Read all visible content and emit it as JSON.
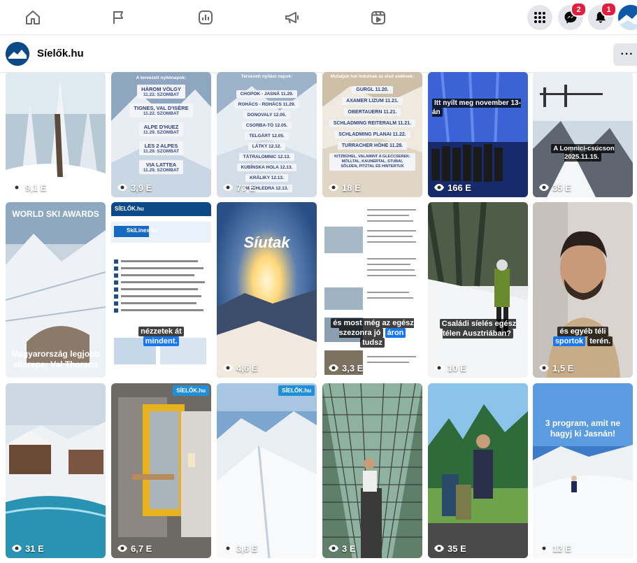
{
  "nav": {
    "icons": [
      "home-icon",
      "flag-icon",
      "insights-icon",
      "megaphone-icon",
      "video-icon"
    ],
    "messenger_badge": "2",
    "notifications_badge": "1"
  },
  "page": {
    "name": "Síelők.hu",
    "avatar_text": "SÍELŐK.hu",
    "more": "···"
  },
  "tiles": [
    {
      "views": "9,1 E"
    },
    {
      "views": "3,9 E",
      "header": "A tervezett nyitónapok:",
      "items": [
        {
          "title": "HÁROM VÖLGY",
          "sub": "11.22. SZOMBAT"
        },
        {
          "title": "TIGNES, VAL D'ISÈRE",
          "sub": "11.22. SZOMBAT"
        },
        {
          "title": "ALPE D'HUEZ",
          "sub": "11.29. SZOMBAT"
        },
        {
          "title": "LES 2 ALPES",
          "sub": "11.29. SZOMBAT"
        },
        {
          "title": "VIA LATTEA",
          "sub": "11.29. SZOMBAT"
        }
      ]
    },
    {
      "views": "73 E",
      "header": "Tervezett nyitási napok:",
      "items": [
        {
          "title": "CHOPOK - JASNÁ 11.29."
        },
        {
          "title": "ROHÁCS - ROHÁCS 11.29."
        },
        {
          "title": "DONOVALY 12.05."
        },
        {
          "title": "CSORBA-TÓ 12.05."
        },
        {
          "title": "TELGÁRT 12.05."
        },
        {
          "title": "LÁTKY 12.12."
        },
        {
          "title": "TÁTRALOMNIC 12.13."
        },
        {
          "title": "KUBÍNSKA HOLA 12.13."
        },
        {
          "title": "KRÁLIKY 12.13."
        },
        {
          "title": "MACHLEDRA 12.13."
        }
      ]
    },
    {
      "views": "18 E",
      "header": "Mutatjuk hol indulnak az első síelések:",
      "items": [
        {
          "title": "GURGL 11.20."
        },
        {
          "title": "AXAMER LIZUM 11.21."
        },
        {
          "title": "OBERTAUERN 11.21."
        },
        {
          "title": "SCHLADMING REITERALM 11.21."
        },
        {
          "title": "SCHLADMING PLANAI 11.22."
        },
        {
          "title": "TURRACHER HÖHE 11.28."
        },
        {
          "title": "KITZBÜHEL, VALAMINT A GLECCSEREK: MÖLLTAL, KAUNERTAL, STUBAI, SÖLDEN, PITZTAL ÉS HINTERTUX"
        }
      ]
    },
    {
      "views": "166 E",
      "caption": "Itt nyílt meg november 13-án"
    },
    {
      "views": "35 E",
      "caption": "A Lomnici-csúcson 2025.11.15."
    },
    {
      "views": "",
      "caption": "Magyarország legjobb síterepe: Val Thorens",
      "logo": "WORLD SKI AWARDS"
    },
    {
      "views": "",
      "caption_a": "nézzetek át",
      "caption_b": "mindent.",
      "brand": "SÍELŐK.hu",
      "site": "SkiLines.hu"
    },
    {
      "views": "4,6 E",
      "logo": "Síutak"
    },
    {
      "views": "3,3 E",
      "caption_a": "és most még az egész szezonra jó",
      "caption_b": "áron",
      "caption_c": "tudsz"
    },
    {
      "views": "10 E",
      "caption": "Családi síelés egész télen Ausztriában?"
    },
    {
      "views": "1,5 E",
      "caption_a": "és egyéb téli",
      "caption_b": "sportok",
      "caption_c": "terén."
    },
    {
      "views": "31 E"
    },
    {
      "views": "6,7 E",
      "brand": "SÍELŐK.hu"
    },
    {
      "views": "3,6 E",
      "brand": "SÍELŐK.hu"
    },
    {
      "views": "3 E"
    },
    {
      "views": "35 E"
    },
    {
      "views": "12 E",
      "caption": "3 program, amit ne hagyj ki Jasnán!"
    }
  ]
}
